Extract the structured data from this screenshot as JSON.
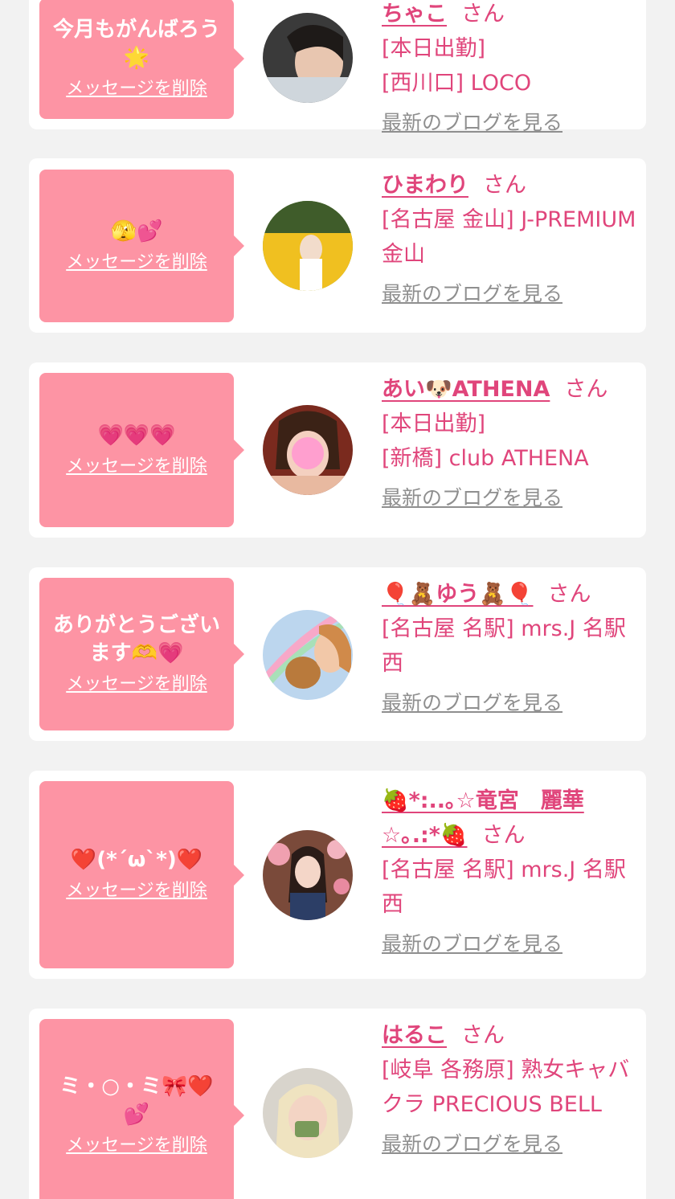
{
  "cards": [
    {
      "message": "今月もがんばろう🌟",
      "delete_label": "メッセージを削除",
      "name": "ちゃこ",
      "honorific": "さん",
      "details": [
        "[本日出勤]",
        "[西川口] LOCO"
      ],
      "blog_label": "最新のブログを見る"
    },
    {
      "message": "🫣💕",
      "delete_label": "メッセージを削除",
      "name": "ひまわり",
      "honorific": "さん",
      "details": [
        "[名古屋 金山] J-PREMIUM 金山"
      ],
      "blog_label": "最新のブログを見る"
    },
    {
      "message": "💗💗💗",
      "delete_label": "メッセージを削除",
      "name": "あい🐶ATHENA",
      "honorific": "さん",
      "details": [
        "[本日出勤]",
        "[新橋] club ATHENA"
      ],
      "blog_label": "最新のブログを見る"
    },
    {
      "message": "ありがとうございます🫶💗",
      "delete_label": "メッセージを削除",
      "name": "🎈🧸ゆう🧸🎈",
      "honorific": "さん",
      "details": [
        "[名古屋 名駅] mrs.J 名駅西"
      ],
      "blog_label": "最新のブログを見る"
    },
    {
      "message": "❤️(*´ω`*)❤️",
      "delete_label": "メッセージを削除",
      "name": "🍓*:..｡☆竜宮　麗華☆｡.:*🍓",
      "honorific": "さん",
      "details": [
        "[名古屋 名駅] mrs.J 名駅西"
      ],
      "blog_label": "最新のブログを見る"
    },
    {
      "message": "ミ・○・ミ🎀❤️💕",
      "delete_label": "メッセージを削除",
      "name": "はるこ",
      "honorific": "さん",
      "details": [
        "[岐阜 各務原]  熟女キャバクラ PRECIOUS BELL"
      ],
      "blog_label": "最新のブログを見る"
    }
  ],
  "colors": {
    "page_background": "#f2f2f2",
    "card_background": "#ffffff",
    "bubble_background": "#fd94a4",
    "accent_pink": "#e0457b",
    "link_gray": "#8f8f8f"
  }
}
